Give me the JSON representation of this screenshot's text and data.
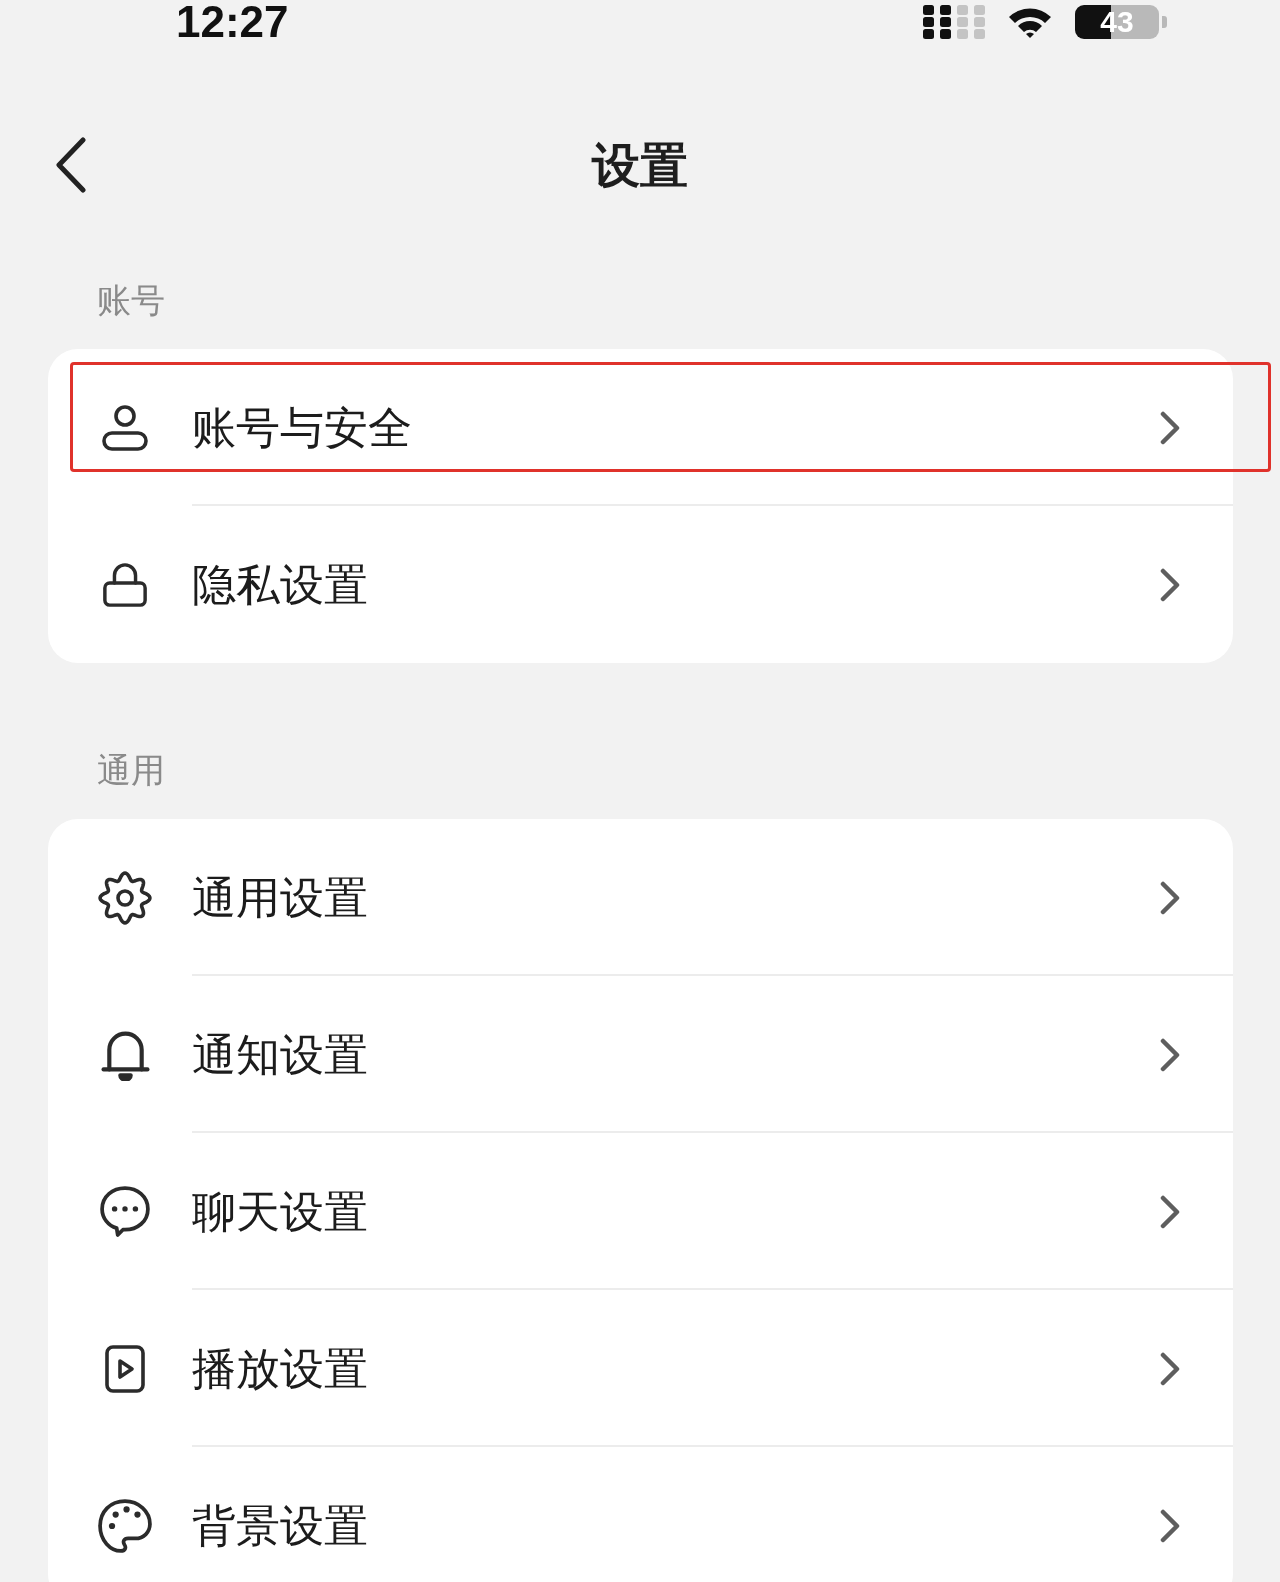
{
  "status_bar": {
    "time": "12:27",
    "battery": "43"
  },
  "nav_bar": {
    "title": "设置"
  },
  "sections": [
    {
      "title": "账号",
      "items": [
        {
          "kind": "account",
          "label": "账号与安全",
          "highlighted": true
        },
        {
          "kind": "privacy",
          "label": "隐私设置",
          "highlighted": false
        }
      ]
    },
    {
      "title": "通用",
      "items": [
        {
          "kind": "general",
          "label": "通用设置",
          "highlighted": false
        },
        {
          "kind": "notify",
          "label": "通知设置",
          "highlighted": false
        },
        {
          "kind": "chat",
          "label": "聊天设置",
          "highlighted": false
        },
        {
          "kind": "playback",
          "label": "播放设置",
          "highlighted": false
        },
        {
          "kind": "theme",
          "label": "背景设置",
          "highlighted": false
        }
      ]
    }
  ]
}
